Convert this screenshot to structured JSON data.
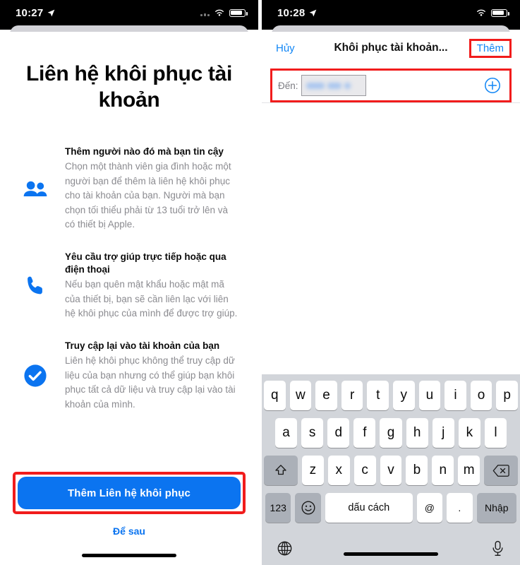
{
  "left_phone": {
    "status_bar": {
      "time": "10:27",
      "location_icon": "location-arrow-icon",
      "signal_icon": "cellular-signal-icon",
      "wifi_icon": "wifi-icon",
      "battery_icon": "battery-icon"
    },
    "title": "Liên hệ khôi phục tài khoản",
    "features": [
      {
        "icon": "two-people-icon",
        "heading": "Thêm người nào đó mà bạn tin cậy",
        "body": "Chọn một thành viên gia đình hoặc một người bạn để thêm là liên hệ khôi phục cho tài khoản của bạn. Người mà bạn chọn tối thiểu phải từ 13 tuổi trở lên và có thiết bị Apple."
      },
      {
        "icon": "phone-handset-icon",
        "heading": "Yêu cầu trợ giúp trực tiếp hoặc qua điện thoại",
        "body": "Nếu bạn quên mật khẩu hoặc mật mã của thiết bị, bạn sẽ cần liên lạc với liên hệ khôi phục của mình để được trợ giúp."
      },
      {
        "icon": "check-circle-icon",
        "heading": "Truy cập lại vào tài khoản của bạn",
        "body": "Liên hệ khôi phục không thể truy cập dữ liệu của bạn nhưng có thể giúp bạn khôi phục tất cả dữ liệu và truy cập lại vào tài khoản của mình."
      }
    ],
    "primary_button": "Thêm Liên hệ khôi phục",
    "secondary_link": "Để sau"
  },
  "right_phone": {
    "status_bar": {
      "time": "10:28",
      "location_icon": "location-arrow-icon",
      "wifi_icon": "wifi-icon",
      "battery_icon": "battery-icon"
    },
    "nav": {
      "cancel": "Hủy",
      "title": "Khôi phục tài khoản...",
      "add": "Thêm"
    },
    "to_field": {
      "label": "Đến:",
      "value": "",
      "placeholder": "",
      "add_contact_icon": "circle-plus-icon"
    },
    "keyboard": {
      "row1": [
        "q",
        "w",
        "e",
        "r",
        "t",
        "y",
        "u",
        "i",
        "o",
        "p"
      ],
      "row2": [
        "a",
        "s",
        "d",
        "f",
        "g",
        "h",
        "j",
        "k",
        "l"
      ],
      "row3": [
        "z",
        "x",
        "c",
        "v",
        "b",
        "n",
        "m"
      ],
      "shift_icon": "shift-arrow-icon",
      "backspace_icon": "backspace-icon",
      "numbers_key": "123",
      "emoji_icon": "smiley-face-icon",
      "space_key": "dấu cách",
      "at_key": "@",
      "period_key": ".",
      "enter_key": "Nhập",
      "globe_icon": "globe-icon",
      "microphone_icon": "microphone-icon"
    }
  },
  "annotations": {
    "highlight_color": "#f11c1c",
    "accent_blue": "#0b74f0",
    "link_blue": "#1186f5"
  }
}
